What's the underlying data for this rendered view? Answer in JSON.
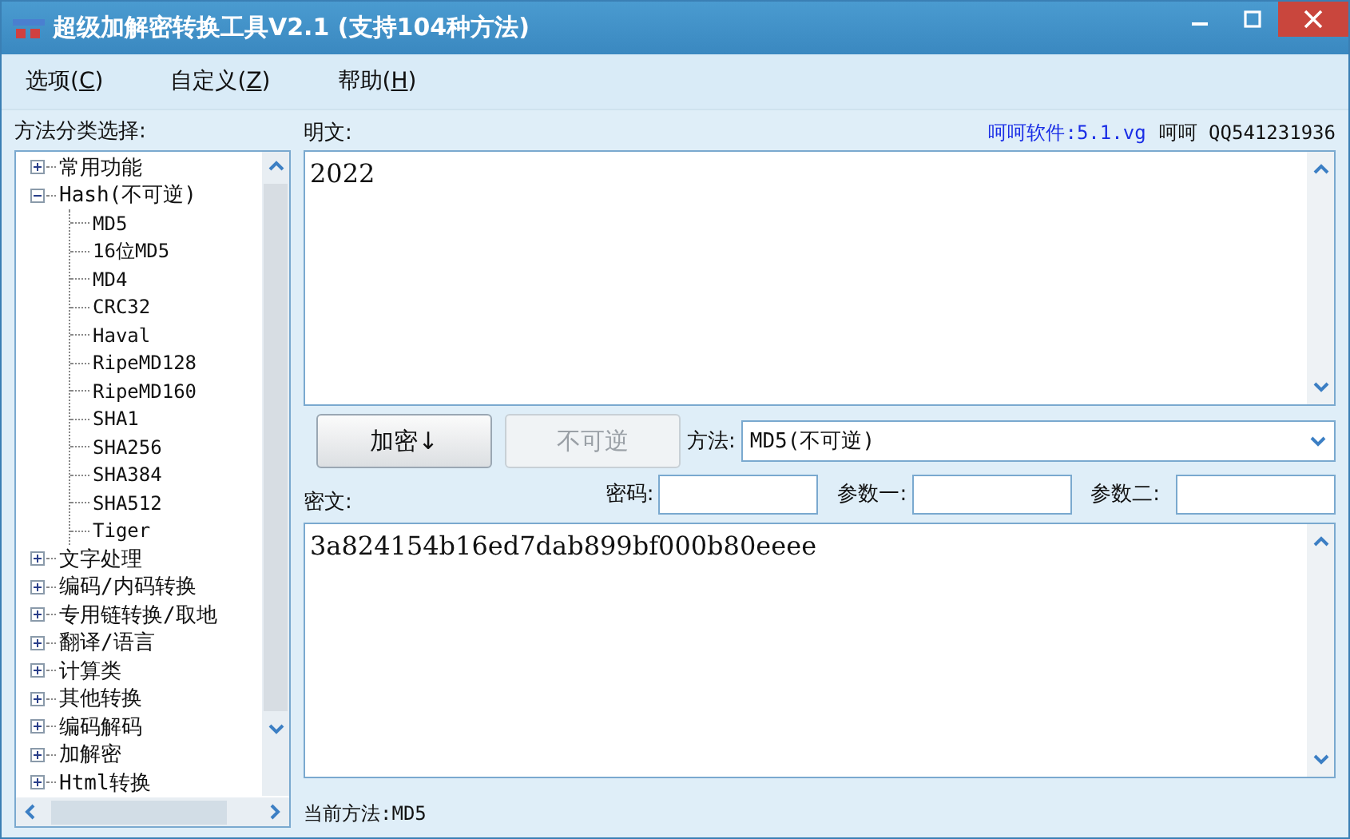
{
  "window": {
    "title": "超级加解密转换工具V2.1 (支持104种方法)"
  },
  "menu": [
    {
      "label": "选项(C)"
    },
    {
      "label": "自定义(Z)"
    },
    {
      "label": "帮助(H)"
    }
  ],
  "tree": {
    "label": "方法分类选择:",
    "items": [
      {
        "label": "常用功能",
        "expanded": false
      },
      {
        "label": "Hash(不可逆)",
        "expanded": true,
        "children": [
          {
            "label": "MD5"
          },
          {
            "label": "16位MD5"
          },
          {
            "label": "MD4"
          },
          {
            "label": "CRC32"
          },
          {
            "label": "Haval"
          },
          {
            "label": "RipeMD128"
          },
          {
            "label": "RipeMD160"
          },
          {
            "label": "SHA1"
          },
          {
            "label": "SHA256"
          },
          {
            "label": "SHA384"
          },
          {
            "label": "SHA512"
          },
          {
            "label": "Tiger"
          }
        ]
      },
      {
        "label": "文字处理",
        "expanded": false
      },
      {
        "label": "编码/内码转换",
        "expanded": false
      },
      {
        "label": "专用链转换/取地",
        "expanded": false
      },
      {
        "label": "翻译/语言",
        "expanded": false
      },
      {
        "label": "计算类",
        "expanded": false
      },
      {
        "label": "其他转换",
        "expanded": false
      },
      {
        "label": "编码解码",
        "expanded": false
      },
      {
        "label": "加解密",
        "expanded": false
      },
      {
        "label": "Html转换",
        "expanded": false
      }
    ]
  },
  "plaintext": {
    "label": "明文:",
    "value": "2022"
  },
  "header_link": "呵呵软件:5.1.vg",
  "header_contact": "呵呵 QQ541231936",
  "buttons": [
    {
      "label": "加密↓",
      "disabled": false
    },
    {
      "label": "不可逆",
      "disabled": true
    }
  ],
  "method": {
    "label": "方法:",
    "value": "MD5(不可逆)"
  },
  "ciphertext": {
    "label": "密文:",
    "value": "3a824154b16ed7dab899bf000b80eeee"
  },
  "params": [
    {
      "label": "密码:"
    },
    {
      "label": "参数一:"
    },
    {
      "label": "参数二:"
    }
  ],
  "status_bar": "当前方法:MD5"
}
